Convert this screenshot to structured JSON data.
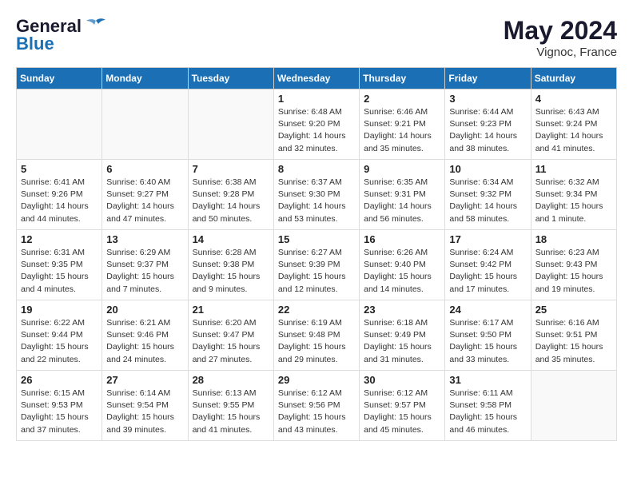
{
  "header": {
    "logo_line1": "General",
    "logo_line2": "Blue",
    "month": "May 2024",
    "location": "Vignoc, France"
  },
  "weekdays": [
    "Sunday",
    "Monday",
    "Tuesday",
    "Wednesday",
    "Thursday",
    "Friday",
    "Saturday"
  ],
  "weeks": [
    [
      {
        "day": "",
        "info": ""
      },
      {
        "day": "",
        "info": ""
      },
      {
        "day": "",
        "info": ""
      },
      {
        "day": "1",
        "info": "Sunrise: 6:48 AM\nSunset: 9:20 PM\nDaylight: 14 hours\nand 32 minutes."
      },
      {
        "day": "2",
        "info": "Sunrise: 6:46 AM\nSunset: 9:21 PM\nDaylight: 14 hours\nand 35 minutes."
      },
      {
        "day": "3",
        "info": "Sunrise: 6:44 AM\nSunset: 9:23 PM\nDaylight: 14 hours\nand 38 minutes."
      },
      {
        "day": "4",
        "info": "Sunrise: 6:43 AM\nSunset: 9:24 PM\nDaylight: 14 hours\nand 41 minutes."
      }
    ],
    [
      {
        "day": "5",
        "info": "Sunrise: 6:41 AM\nSunset: 9:26 PM\nDaylight: 14 hours\nand 44 minutes."
      },
      {
        "day": "6",
        "info": "Sunrise: 6:40 AM\nSunset: 9:27 PM\nDaylight: 14 hours\nand 47 minutes."
      },
      {
        "day": "7",
        "info": "Sunrise: 6:38 AM\nSunset: 9:28 PM\nDaylight: 14 hours\nand 50 minutes."
      },
      {
        "day": "8",
        "info": "Sunrise: 6:37 AM\nSunset: 9:30 PM\nDaylight: 14 hours\nand 53 minutes."
      },
      {
        "day": "9",
        "info": "Sunrise: 6:35 AM\nSunset: 9:31 PM\nDaylight: 14 hours\nand 56 minutes."
      },
      {
        "day": "10",
        "info": "Sunrise: 6:34 AM\nSunset: 9:32 PM\nDaylight: 14 hours\nand 58 minutes."
      },
      {
        "day": "11",
        "info": "Sunrise: 6:32 AM\nSunset: 9:34 PM\nDaylight: 15 hours\nand 1 minute."
      }
    ],
    [
      {
        "day": "12",
        "info": "Sunrise: 6:31 AM\nSunset: 9:35 PM\nDaylight: 15 hours\nand 4 minutes."
      },
      {
        "day": "13",
        "info": "Sunrise: 6:29 AM\nSunset: 9:37 PM\nDaylight: 15 hours\nand 7 minutes."
      },
      {
        "day": "14",
        "info": "Sunrise: 6:28 AM\nSunset: 9:38 PM\nDaylight: 15 hours\nand 9 minutes."
      },
      {
        "day": "15",
        "info": "Sunrise: 6:27 AM\nSunset: 9:39 PM\nDaylight: 15 hours\nand 12 minutes."
      },
      {
        "day": "16",
        "info": "Sunrise: 6:26 AM\nSunset: 9:40 PM\nDaylight: 15 hours\nand 14 minutes."
      },
      {
        "day": "17",
        "info": "Sunrise: 6:24 AM\nSunset: 9:42 PM\nDaylight: 15 hours\nand 17 minutes."
      },
      {
        "day": "18",
        "info": "Sunrise: 6:23 AM\nSunset: 9:43 PM\nDaylight: 15 hours\nand 19 minutes."
      }
    ],
    [
      {
        "day": "19",
        "info": "Sunrise: 6:22 AM\nSunset: 9:44 PM\nDaylight: 15 hours\nand 22 minutes."
      },
      {
        "day": "20",
        "info": "Sunrise: 6:21 AM\nSunset: 9:46 PM\nDaylight: 15 hours\nand 24 minutes."
      },
      {
        "day": "21",
        "info": "Sunrise: 6:20 AM\nSunset: 9:47 PM\nDaylight: 15 hours\nand 27 minutes."
      },
      {
        "day": "22",
        "info": "Sunrise: 6:19 AM\nSunset: 9:48 PM\nDaylight: 15 hours\nand 29 minutes."
      },
      {
        "day": "23",
        "info": "Sunrise: 6:18 AM\nSunset: 9:49 PM\nDaylight: 15 hours\nand 31 minutes."
      },
      {
        "day": "24",
        "info": "Sunrise: 6:17 AM\nSunset: 9:50 PM\nDaylight: 15 hours\nand 33 minutes."
      },
      {
        "day": "25",
        "info": "Sunrise: 6:16 AM\nSunset: 9:51 PM\nDaylight: 15 hours\nand 35 minutes."
      }
    ],
    [
      {
        "day": "26",
        "info": "Sunrise: 6:15 AM\nSunset: 9:53 PM\nDaylight: 15 hours\nand 37 minutes."
      },
      {
        "day": "27",
        "info": "Sunrise: 6:14 AM\nSunset: 9:54 PM\nDaylight: 15 hours\nand 39 minutes."
      },
      {
        "day": "28",
        "info": "Sunrise: 6:13 AM\nSunset: 9:55 PM\nDaylight: 15 hours\nand 41 minutes."
      },
      {
        "day": "29",
        "info": "Sunrise: 6:12 AM\nSunset: 9:56 PM\nDaylight: 15 hours\nand 43 minutes."
      },
      {
        "day": "30",
        "info": "Sunrise: 6:12 AM\nSunset: 9:57 PM\nDaylight: 15 hours\nand 45 minutes."
      },
      {
        "day": "31",
        "info": "Sunrise: 6:11 AM\nSunset: 9:58 PM\nDaylight: 15 hours\nand 46 minutes."
      },
      {
        "day": "",
        "info": ""
      }
    ]
  ]
}
